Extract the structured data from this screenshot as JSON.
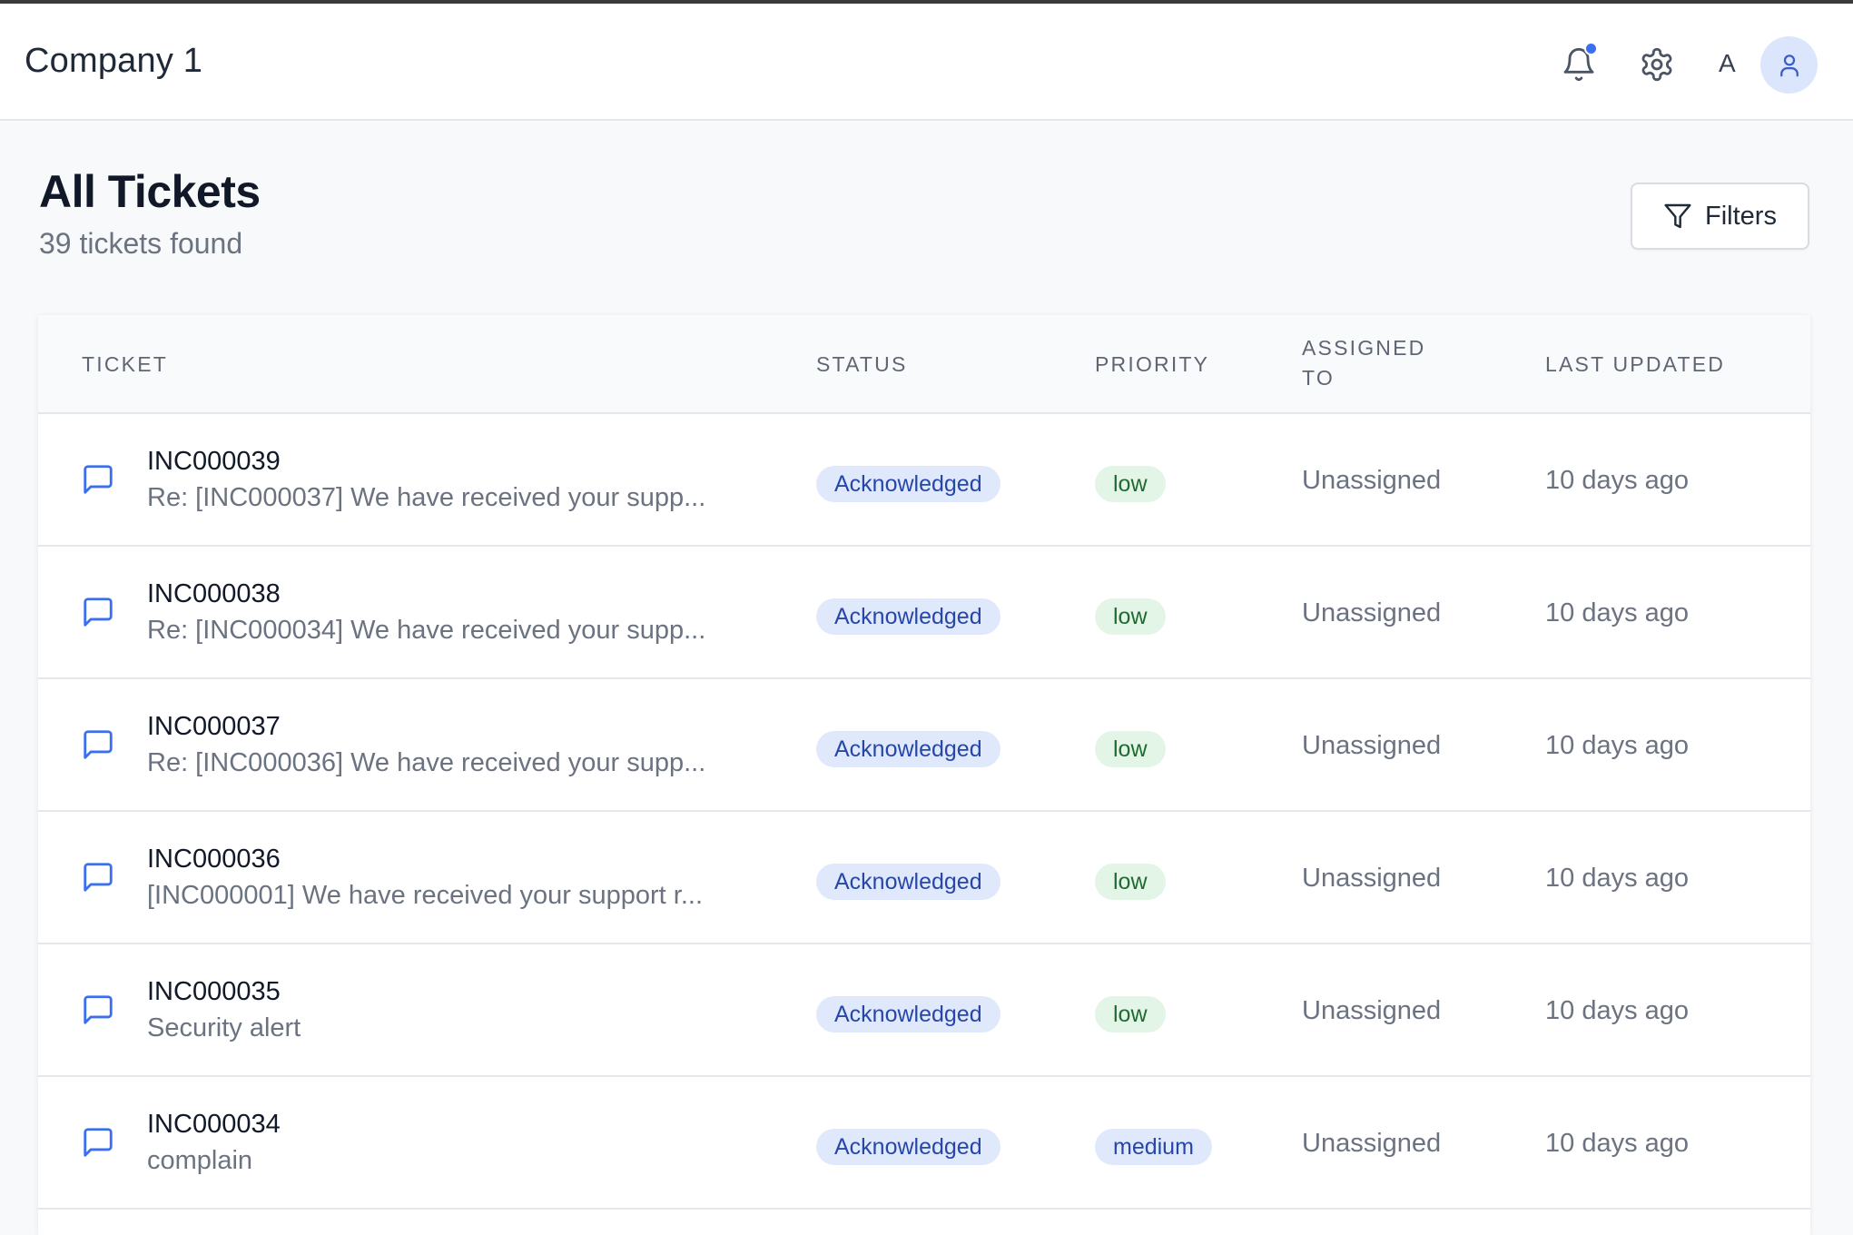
{
  "header": {
    "company": "Company 1",
    "user_initial": "A",
    "icons": [
      "bell-icon",
      "gear-icon",
      "user-icon"
    ],
    "notification_dot_color": "#3b6ff0"
  },
  "page": {
    "title": "All Tickets",
    "subtitle": "39 tickets found",
    "filters_label": "Filters"
  },
  "table": {
    "columns": {
      "ticket": "TICKET",
      "status": "STATUS",
      "priority": "PRIORITY",
      "assigned_to": "ASSIGNED TO",
      "last_updated": "LAST UPDATED"
    },
    "rows": [
      {
        "id": "INC000039",
        "subject": "Re: [INC000037] We have received your supp...",
        "status": "Acknowledged",
        "priority": "low",
        "assigned": "Unassigned",
        "updated": "10 days ago"
      },
      {
        "id": "INC000038",
        "subject": "Re: [INC000034] We have received your supp...",
        "status": "Acknowledged",
        "priority": "low",
        "assigned": "Unassigned",
        "updated": "10 days ago"
      },
      {
        "id": "INC000037",
        "subject": "Re: [INC000036] We have received your supp...",
        "status": "Acknowledged",
        "priority": "low",
        "assigned": "Unassigned",
        "updated": "10 days ago"
      },
      {
        "id": "INC000036",
        "subject": "[INC000001] We have received your support r...",
        "status": "Acknowledged",
        "priority": "low",
        "assigned": "Unassigned",
        "updated": "10 days ago"
      },
      {
        "id": "INC000035",
        "subject": "Security alert",
        "status": "Acknowledged",
        "priority": "low",
        "assigned": "Unassigned",
        "updated": "10 days ago"
      },
      {
        "id": "INC000034",
        "subject": "complain",
        "status": "Acknowledged",
        "priority": "medium",
        "assigned": "Unassigned",
        "updated": "10 days ago"
      }
    ]
  },
  "colors": {
    "accent": "#3b6ff0",
    "status_badge_bg": "#e0e8fb",
    "low_badge_bg": "#e3f5e6",
    "medium_badge_bg": "#e0e8fb"
  }
}
